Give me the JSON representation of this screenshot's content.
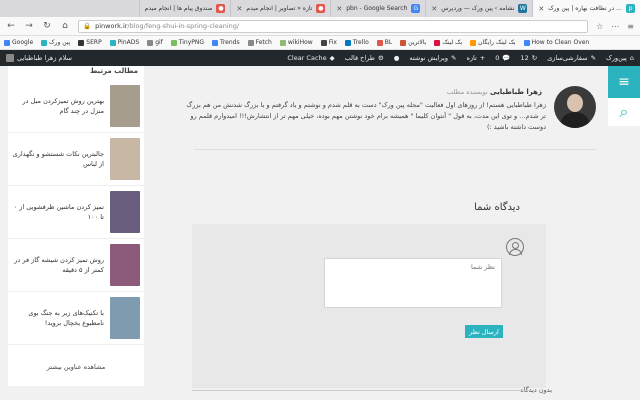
{
  "tabs": [
    {
      "title": "… در نظافت بهاره | پین ورک",
      "color": "#2bb3c0",
      "active": true
    },
    {
      "title": "نشامه › پین ورک — وردپرس",
      "color": "#21759b",
      "active": false
    },
    {
      "title": "pbn - Google Search",
      "color": "#4285f4",
      "active": false
    },
    {
      "title": "تازه « تصاویر | انجام میدم",
      "color": "#e2574c",
      "active": false
    },
    {
      "title": "صندوق پیام ها | انجام میدم",
      "color": "#e2574c",
      "active": false
    }
  ],
  "url": {
    "domain": "pinwork.ir",
    "path": "/blog/feng-shui-in-spring-cleaning/"
  },
  "bookmarks": [
    {
      "label": "Google",
      "color": "#4285f4"
    },
    {
      "label": "پین ورک",
      "color": "#2bb3c0"
    },
    {
      "label": "SERP",
      "color": "#333"
    },
    {
      "label": "PinADS",
      "color": "#2bb3c0"
    },
    {
      "label": "gif",
      "color": "#888"
    },
    {
      "label": "TinyPNG",
      "color": "#7bbf5a"
    },
    {
      "label": "Trends",
      "color": "#4285f4"
    },
    {
      "label": "Fetch",
      "color": "#888"
    },
    {
      "label": "wikiHow",
      "color": "#93b874"
    },
    {
      "label": "Fix",
      "color": "#444"
    },
    {
      "label": "Trello",
      "color": "#0079bf"
    },
    {
      "label": "BL",
      "color": "#e2574c"
    },
    {
      "label": "بالاترین",
      "color": "#c53"
    },
    {
      "label": "بک لینک",
      "color": "#d14"
    },
    {
      "label": "بک لینک رایگان",
      "color": "#f90"
    },
    {
      "label": "How to Clean Oven",
      "color": "#4285f4"
    }
  ],
  "adminbar": {
    "greeting": "سلام زهرا طباطبایی",
    "clear_cache": "Clear Cache",
    "theme": "طراح قالب",
    "edit": "ویرایش نوشته",
    "comments": "0",
    "updates": "12",
    "new": "تازه",
    "customize": "سفارشی‌سازی",
    "site": "پین‌ورک"
  },
  "sidebar": {
    "heading": "مطالب مرتبط",
    "posts": [
      {
        "title": "بهترین روش تمیزکردن مبل در منزل در چند گام",
        "color": "#a79d8f"
      },
      {
        "title": "جالبترین نکات شستشو و نگهداری از لباس",
        "color": "#c9b7a6"
      },
      {
        "title": "تمیز کردن ماشین ظرفشویی از ۰ تا ۱۰۰",
        "color": "#6a5e7f"
      },
      {
        "title": "روش تمیز کردن شیشه گاز فر در کمتر از ۵ دقیقه",
        "color": "#8c5a7a"
      },
      {
        "title": "با تکنیک‌های زیر به جنگ بوی نامطبوع یخچال بروید!",
        "color": "#7f9bb0"
      }
    ],
    "more": "مشاهده عناوین بیشتر"
  },
  "author": {
    "meta": "نویسنده مطلب",
    "name": "زهرا طباطبایی",
    "bio": "زهرا طباطبایی هستم! از روزهای اول فعالیت \"مجله پین ورک\" دست به قلم شدم و نوشتم و یاد گرفتم و با بزرگ شدنش من هم بزرگ تر شدم… و توی این مدت، به قول \" آنتوان کلیما \" همیشه برام خود نوشتن مهم بوده، خیلی مهم تر از انتشارش!!! امیدوارم قلمم رو دوست داشته باشید :)"
  },
  "comments": {
    "title": "دیدگاه شما",
    "placeholder": "نظر شما",
    "submit": "ارسال نظر",
    "none": "بدون دیدگاه"
  }
}
